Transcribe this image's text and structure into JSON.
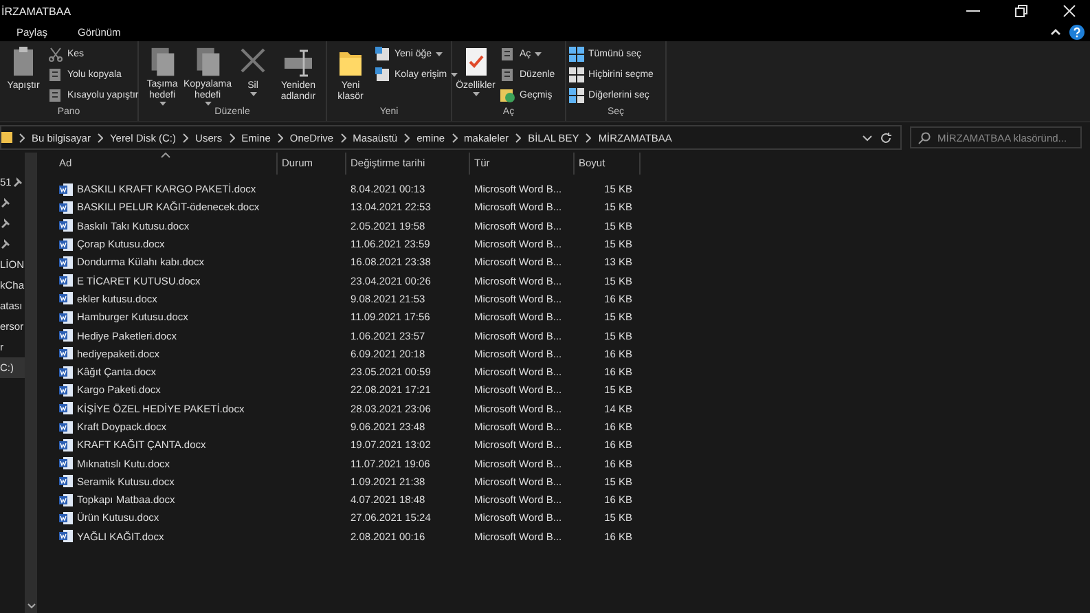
{
  "window": {
    "title": "İRZAMATBAA"
  },
  "tabs": [
    {
      "label": "Paylaş",
      "selected": false
    },
    {
      "label": "Görünüm",
      "selected": false
    }
  ],
  "ribbon": {
    "groups": [
      {
        "label": "Pano",
        "items": [
          {
            "kind": "large",
            "label": "Yapıştır"
          },
          {
            "kind": "small",
            "label": "Kes"
          },
          {
            "kind": "small",
            "label": "Yolu kopyala"
          },
          {
            "kind": "small",
            "label": "Kısayolu yapıştır"
          }
        ]
      },
      {
        "label": "Düzenle",
        "items": [
          {
            "kind": "large",
            "label": "Taşıma hedefi",
            "dropdown": true
          },
          {
            "kind": "large",
            "label": "Kopyalama hedefi",
            "dropdown": true
          },
          {
            "kind": "large",
            "label": "Sil",
            "dropdown": true
          },
          {
            "kind": "large",
            "label": "Yeniden adlandır",
            "dropdown": false
          }
        ]
      },
      {
        "label": "Yeni",
        "items": [
          {
            "kind": "large",
            "label": "Yeni klasör",
            "dropdown": false
          },
          {
            "kind": "small",
            "label": "Yeni öğe",
            "dropdown": true
          },
          {
            "kind": "small",
            "label": "Kolay erişim",
            "dropdown": true
          }
        ]
      },
      {
        "label": "Aç",
        "items": [
          {
            "kind": "large",
            "label": "Özellikler",
            "dropdown": true
          },
          {
            "kind": "small",
            "label": "Aç",
            "dropdown": true
          },
          {
            "kind": "small",
            "label": "Düzenle"
          },
          {
            "kind": "small",
            "label": "Geçmiş"
          }
        ]
      },
      {
        "label": "Seç",
        "items": [
          {
            "kind": "small",
            "label": "Tümünü seç"
          },
          {
            "kind": "small",
            "label": "Hiçbirini seçme"
          },
          {
            "kind": "small",
            "label": "Diğerlerini seç"
          }
        ]
      }
    ]
  },
  "breadcrumb": [
    "Bu bilgisayar",
    "Yerel Disk (C:)",
    "Users",
    "Emine",
    "OneDrive",
    "Masaüstü",
    "emine",
    "makaleler",
    "BİLAL BEY",
    "MİRZAMATBAA"
  ],
  "search": {
    "placeholder": "MİRZAMATBAA klasöründ..."
  },
  "sidebar": {
    "items": [
      {
        "label": "51",
        "pinned": true,
        "selected": false
      },
      {
        "pinned": true,
        "selected": false
      },
      {
        "pinned": true,
        "selected": false
      },
      {
        "pinned": true,
        "selected": false
      },
      {
        "label": "LİON",
        "pinned": false,
        "selected": false
      },
      {
        "label": "kCha",
        "pinned": false,
        "selected": false
      },
      {
        "label": "atası",
        "pinned": false,
        "selected": false
      },
      {
        "label": "ersor",
        "pinned": false,
        "selected": false
      },
      {
        "label": "r",
        "pinned": false,
        "selected": false
      },
      {
        "label": "C:)",
        "pinned": false,
        "selected": true
      }
    ]
  },
  "table": {
    "columns": [
      "Ad",
      "Durum",
      "Değiştirme tarihi",
      "Tür",
      "Boyut"
    ],
    "rows": [
      {
        "name": "BASKILI KRAFT KARGO PAKETİ.docx",
        "date": "8.04.2021 00:13",
        "type": "Microsoft Word B...",
        "size": "15 KB"
      },
      {
        "name": "BASKILI PELUR KAĞIT-ödenecek.docx",
        "date": "13.04.2021 22:53",
        "type": "Microsoft Word B...",
        "size": "15 KB"
      },
      {
        "name": "Baskılı Takı Kutusu.docx",
        "date": "2.05.2021 19:58",
        "type": "Microsoft Word B...",
        "size": "15 KB"
      },
      {
        "name": "Çorap Kutusu.docx",
        "date": "11.06.2021 23:59",
        "type": "Microsoft Word B...",
        "size": "15 KB"
      },
      {
        "name": "Dondurma Külahı kabı.docx",
        "date": "16.08.2021 23:38",
        "type": "Microsoft Word B...",
        "size": "13 KB"
      },
      {
        "name": "E TİCARET KUTUSU.docx",
        "date": "23.04.2021 00:26",
        "type": "Microsoft Word B...",
        "size": "15 KB"
      },
      {
        "name": "ekler kutusu.docx",
        "date": "9.08.2021 21:53",
        "type": "Microsoft Word B...",
        "size": "16 KB"
      },
      {
        "name": "Hamburger Kutusu.docx",
        "date": "11.09.2021 17:56",
        "type": "Microsoft Word B...",
        "size": "15 KB"
      },
      {
        "name": "Hediye Paketleri.docx",
        "date": "1.06.2021 23:57",
        "type": "Microsoft Word B...",
        "size": "15 KB"
      },
      {
        "name": "hediyepaketi.docx",
        "date": "6.09.2021 20:18",
        "type": "Microsoft Word B...",
        "size": "16 KB"
      },
      {
        "name": "Kâğıt Çanta.docx",
        "date": "23.05.2021 00:59",
        "type": "Microsoft Word B...",
        "size": "16 KB"
      },
      {
        "name": "Kargo Paketi.docx",
        "date": "22.08.2021 17:21",
        "type": "Microsoft Word B...",
        "size": "15 KB"
      },
      {
        "name": "KİŞİYE ÖZEL HEDİYE PAKETİ.docx",
        "date": "28.03.2021 23:06",
        "type": "Microsoft Word B...",
        "size": "14 KB"
      },
      {
        "name": "Kraft Doypack.docx",
        "date": "9.06.2021 23:48",
        "type": "Microsoft Word B...",
        "size": "16 KB"
      },
      {
        "name": "KRAFT KAĞIT ÇANTA.docx",
        "date": "19.07.2021 13:02",
        "type": "Microsoft Word B...",
        "size": "16 KB"
      },
      {
        "name": "Mıknatıslı Kutu.docx",
        "date": "11.07.2021 19:06",
        "type": "Microsoft Word B...",
        "size": "16 KB"
      },
      {
        "name": "Seramik Kutusu.docx",
        "date": "1.09.2021 21:38",
        "type": "Microsoft Word B...",
        "size": "15 KB"
      },
      {
        "name": "Topkapı Matbaa.docx",
        "date": "4.07.2021 18:48",
        "type": "Microsoft Word B...",
        "size": "16 KB"
      },
      {
        "name": "Ürün Kutusu.docx",
        "date": "27.06.2021 15:24",
        "type": "Microsoft Word B...",
        "size": "15 KB"
      },
      {
        "name": "YAĞLI KAĞIT.docx",
        "date": "2.08.2021 00:16",
        "type": "Microsoft Word B...",
        "size": "16 KB"
      }
    ]
  }
}
